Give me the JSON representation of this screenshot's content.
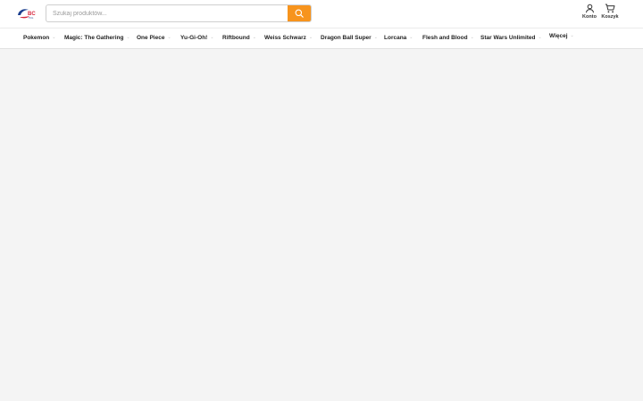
{
  "logo": {
    "text": "BC",
    "sub": "TCG"
  },
  "search": {
    "placeholder": "Szukaj produktów..."
  },
  "account": {
    "label": "Konto"
  },
  "cart": {
    "label": "Koszyk"
  },
  "nav": {
    "items": [
      {
        "label": "Pokemon"
      },
      {
        "label": "Magic: The Gathering"
      },
      {
        "label": "One Piece"
      },
      {
        "label": "Yu-Gi-Oh!"
      },
      {
        "label": "Riftbound"
      },
      {
        "label": "Weiss Schwarz"
      },
      {
        "label": "Dragon Ball Super"
      },
      {
        "label": "Lorcana"
      },
      {
        "label": "Flesh and Blood"
      },
      {
        "label": "Star Wars Unlimited"
      },
      {
        "label": "Więcej"
      }
    ]
  },
  "colors": {
    "accent": "#f7941d",
    "logo_red": "#d7263d",
    "logo_blue": "#1b3f8f",
    "background": "#f4f4f4"
  }
}
